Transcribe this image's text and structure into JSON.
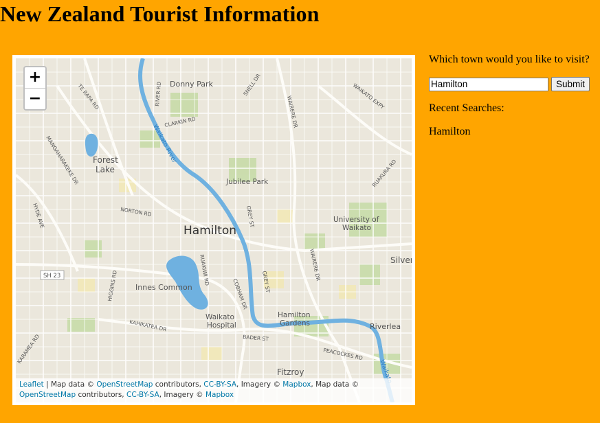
{
  "page": {
    "title": "New Zealand Tourist Information",
    "background": "#ffa500"
  },
  "map": {
    "zoom_in": "+",
    "zoom_out": "−",
    "labels": {
      "city": "Hamilton",
      "donny_park": "Donny Park",
      "forest_lake_1": "Forest",
      "forest_lake_2": "Lake",
      "jubilee_park": "Jubilee Park",
      "university_1": "University of",
      "university_2": "Waikato",
      "silver": "Silver",
      "innes_common": "Innes Common",
      "waikato_hospital_1": "Waikato",
      "waikato_hospital_2": "Hospital",
      "hamilton_gardens_1": "Hamilton",
      "hamilton_gardens_2": "Gardens",
      "riverlea": "Riverlea",
      "fitzroy": "Fitzroy",
      "waikato_river_1": "Waikato River",
      "waikato_river_2": "Waikato",
      "te_rapa_rd": "TE RAPA RD",
      "river_rd": "RIVER RD",
      "clarkin_rd": "CLARKIN RD",
      "snell_dr": "SNELL DR",
      "wairere_dr": "WAIRERE DR",
      "waikato_expy": "WAIKATO EXPY",
      "mangaharakeke_dr": "MANGAHARAKEKE DR",
      "ruakura_rd": "RUAKURA RD",
      "hyde_ave": "HYDE AVE",
      "norton_rd": "NORTON RD",
      "grey_st": "GREY ST",
      "sh23": "SH 23",
      "higgins_rd": "HIGGINS RD",
      "ruakiwi_rd": "RUAKIWI RD",
      "cobham_dr": "COBHAM DR",
      "kahikatea_dr": "KAHIKATEA DR",
      "bader_st": "BADER ST",
      "peacockes_rd": "PEACOCKES RD",
      "karamea_rd": "KARAMEA RD"
    },
    "attribution": {
      "leaflet": "Leaflet",
      "sep1": " | Map data © ",
      "osm1": "OpenStreetMap",
      "text1": " contributors, ",
      "ccbysa1": "CC-BY-SA",
      "text2": ", Imagery © ",
      "mapbox1": "Mapbox",
      "text3": ", Map data © ",
      "osm2": "OpenStreetMap",
      "text4": " contributors, ",
      "ccbysa2": "CC-BY-SA",
      "text5": ", Imagery © ",
      "mapbox2": "Mapbox"
    }
  },
  "search": {
    "question": "Which town would you like to visit?",
    "input_value": "Hamilton",
    "submit_label": "Submit",
    "recent_heading": "Recent Searches:",
    "recent_items": [
      "Hamilton"
    ]
  }
}
